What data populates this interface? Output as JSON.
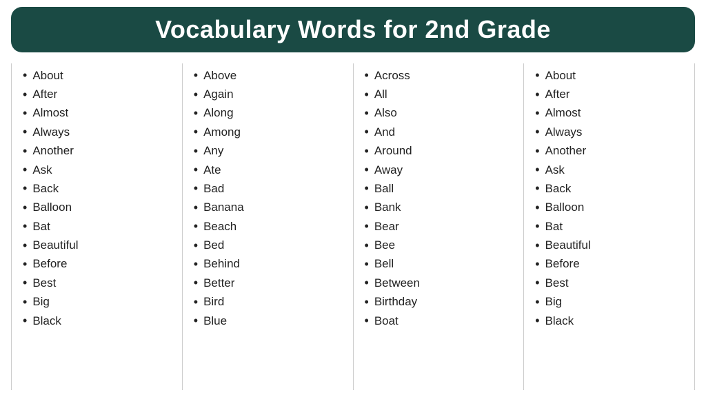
{
  "header": {
    "title": "Vocabulary Words for 2nd Grade"
  },
  "columns": [
    {
      "id": "col1",
      "words": [
        "About",
        "After",
        "Almost",
        "Always",
        "Another",
        "Ask",
        "Back",
        "Balloon",
        "Bat",
        "Beautiful",
        "Before",
        "Best",
        "Big",
        "Black"
      ]
    },
    {
      "id": "col2",
      "words": [
        "Above",
        "Again",
        "Along",
        "Among",
        "Any",
        "Ate",
        "Bad",
        "Banana",
        "Beach",
        "Bed",
        "Behind",
        "Better",
        "Bird",
        "Blue"
      ]
    },
    {
      "id": "col3",
      "words": [
        "Across",
        "All",
        "Also",
        "And",
        "Around",
        "Away",
        "Ball",
        "Bank",
        "Bear",
        "Bee",
        "Bell",
        "Between",
        "Birthday",
        "Boat"
      ]
    },
    {
      "id": "col4",
      "words": [
        "About",
        "After",
        "Almost",
        "Always",
        "Another",
        "Ask",
        "Back",
        "Balloon",
        "Bat",
        "Beautiful",
        "Before",
        "Best",
        "Big",
        "Black"
      ]
    }
  ]
}
